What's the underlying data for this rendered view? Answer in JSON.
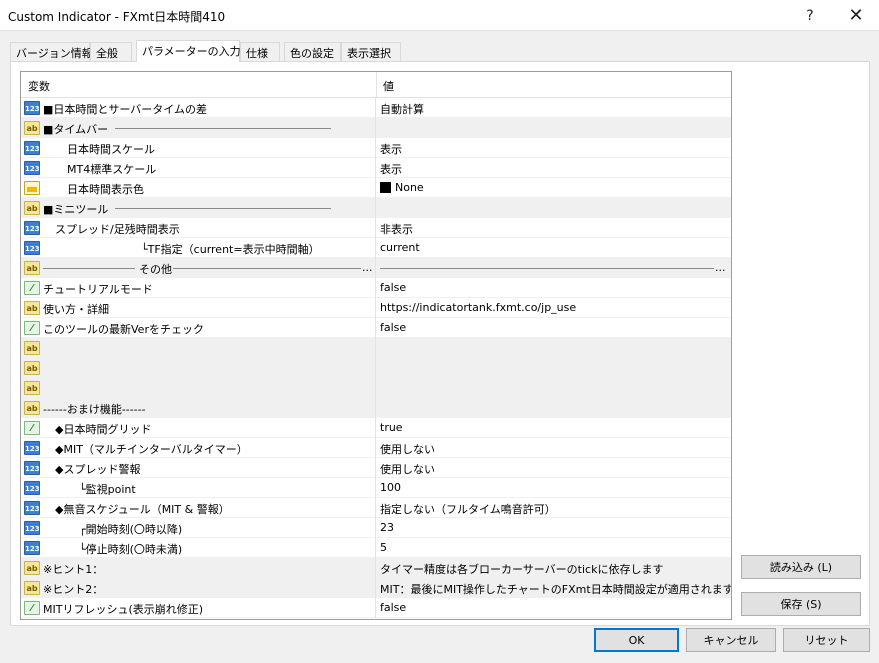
{
  "window": {
    "title": "Custom Indicator - FXmt日本時間410",
    "help_glyph": "?",
    "close_glyph": "✕"
  },
  "tabs": [
    {
      "label": "バージョン情報"
    },
    {
      "label": "全般"
    },
    {
      "label": "パラメーターの入力",
      "active": true
    },
    {
      "label": "仕様"
    },
    {
      "label": "色の設定"
    },
    {
      "label": "表示選択"
    }
  ],
  "grid": {
    "header_variable": "変数",
    "header_value": "値",
    "rows": [
      {
        "icon": "int",
        "name": "■日本時間とサーバータイムの差",
        "indent": 1,
        "value": "自動計算"
      },
      {
        "icon": "str",
        "name": "■タイムバー",
        "indent": 1,
        "section": true,
        "line_after": true,
        "value": ""
      },
      {
        "icon": "int",
        "name": "日本時間スケール",
        "indent": 3,
        "value": "表示"
      },
      {
        "icon": "int",
        "name": "MT4標準スケール",
        "indent": 3,
        "value": "表示"
      },
      {
        "icon": "color",
        "name": "日本時間表示色",
        "indent": 3,
        "value": "None",
        "swatch": true
      },
      {
        "icon": "str",
        "name": "■ミニツール",
        "indent": 1,
        "section": true,
        "line_after": true,
        "value": ""
      },
      {
        "icon": "int",
        "name": "スプレッド/足残時間表示",
        "indent": 2,
        "value": "非表示"
      },
      {
        "icon": "int",
        "name": "└TF指定（current=表示中時間軸）",
        "indent": 6,
        "value": "current"
      },
      {
        "icon": "str",
        "name": "その他",
        "indent": 1,
        "section": true,
        "center_line": true,
        "value": "",
        "value_line": true
      },
      {
        "icon": "bool",
        "name": "チュートリアルモード",
        "indent": 1,
        "value": "false"
      },
      {
        "icon": "str",
        "name": "使い方・詳細",
        "indent": 1,
        "value": "https://indicatortank.fxmt.co/jp_use"
      },
      {
        "icon": "bool",
        "name": "このツールの最新Verをチェック",
        "indent": 1,
        "value": "false"
      },
      {
        "icon": "str",
        "name": "",
        "indent": 1,
        "section": true,
        "value": ""
      },
      {
        "icon": "str",
        "name": "",
        "indent": 1,
        "section": true,
        "value": ""
      },
      {
        "icon": "str",
        "name": "",
        "indent": 1,
        "section": true,
        "value": ""
      },
      {
        "icon": "str",
        "name": "------おまけ機能------",
        "indent": 1,
        "section": true,
        "value": ""
      },
      {
        "icon": "bool",
        "name": "◆日本時間グリッド",
        "indent": 2,
        "value": "true"
      },
      {
        "icon": "int",
        "name": "◆MIT（マルチインターバルタイマー）",
        "indent": 2,
        "value": "使用しない"
      },
      {
        "icon": "int",
        "name": "◆スプレッド警報",
        "indent": 2,
        "value": "使用しない"
      },
      {
        "icon": "int",
        "name": "└監視point",
        "indent": 4,
        "value": "100"
      },
      {
        "icon": "int",
        "name": "◆無音スケジュール（MIT & 警報）",
        "indent": 2,
        "value": "指定しない（フルタイム鳴音許可）"
      },
      {
        "icon": "int",
        "name": "┌開始時刻(〇時以降)",
        "indent": 4,
        "value": "23"
      },
      {
        "icon": "int",
        "name": "└停止時刻(〇時未満)",
        "indent": 4,
        "value": "5"
      },
      {
        "icon": "str",
        "name": "※ヒント1：",
        "indent": 1,
        "section": true,
        "value": "タイマー精度は各ブローカーサーバーのtickに依存します"
      },
      {
        "icon": "str",
        "name": "※ヒント2：",
        "indent": 1,
        "section": true,
        "value": "MIT：最後にMIT操作したチャートのFXmt日本時間設定が適用されます"
      },
      {
        "icon": "bool",
        "name": "MITリフレッシュ(表示崩れ修正)",
        "indent": 1,
        "value": "false"
      }
    ]
  },
  "buttons": {
    "load": "読み込み (L)",
    "save": "保存 (S)",
    "ok": "OK",
    "cancel": "キャンセル",
    "reset": "リセット"
  },
  "icon_labels": {
    "int": "123",
    "str": "ab",
    "bool": "⁄",
    "color": ""
  },
  "ellipsis": "..."
}
